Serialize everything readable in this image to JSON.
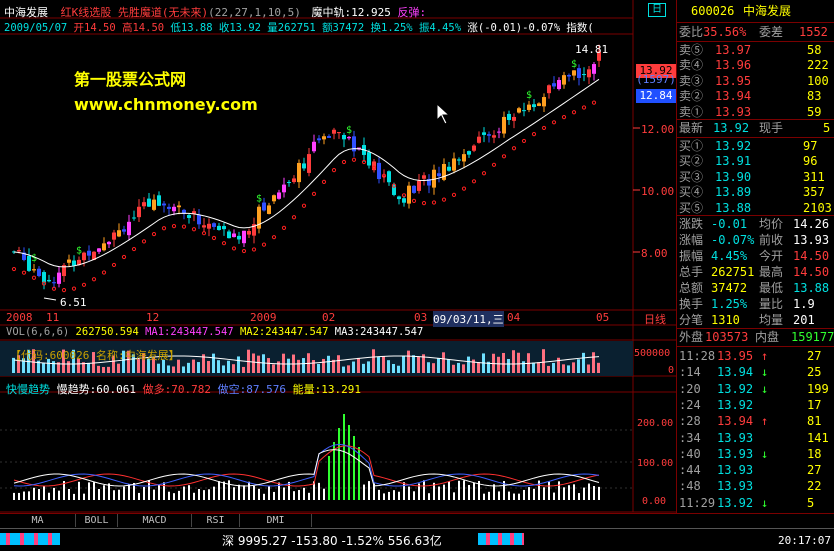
{
  "header": {
    "stock_name": "中海发展",
    "indicator_name": "红K线选股 先胜魔道(无未来)",
    "indicator_params": "(22,27,1,10,5)",
    "demon_line": "魔中轨:12.925",
    "rebound": "反弹:",
    "date": "2009/05/07",
    "open": "开14.50",
    "high": "高14.50",
    "low": "低13.88",
    "close": "收13.92",
    "volume": "量262751",
    "amount": "额37472",
    "turnover": "换1.25%",
    "amplitude": "振4.45%",
    "change": "涨(-0.01)-0.07%",
    "index_label": "指数(",
    "window_btn": "日"
  },
  "watermark": {
    "line1": "第一股票公式网",
    "line2": "www.chnmoney.com"
  },
  "price_axis": {
    "ticks": [
      "13.92",
      "(1597)",
      "12.84",
      "12.00",
      "10.00",
      "8.00"
    ],
    "max_label": "14.81",
    "min_label": "6.51"
  },
  "time_axis": {
    "labels": [
      "2008",
      "11",
      "12",
      "2009",
      "02",
      "03",
      "09/03/11,三",
      "04",
      "05"
    ],
    "period": "日线"
  },
  "volume_panel": {
    "title": "VOL(6,6,6)",
    "vol": "262750.594",
    "ma1": "MA1:243447.547",
    "ma2": "MA2:243447.547",
    "ma3": "MA3:243447.547",
    "banner": "【代码:600026  名称:中海发展】",
    "axis": [
      "500000",
      "0"
    ]
  },
  "indicator_panel": {
    "fast": "快慢趋势",
    "slow": "慢趋势:60.061",
    "short": "做多:70.782",
    "empty": "做空:87.576",
    "energy": "能量:13.291",
    "axis": [
      "200.00",
      "100.00",
      "0.00"
    ]
  },
  "quote_panel": {
    "code": "600026",
    "name": "中海发展",
    "weibi_label": "委比",
    "weibi": "35.56%",
    "weicha_label": "委差",
    "weicha": "1552",
    "sells": [
      {
        "label": "卖⑤",
        "price": "13.97",
        "vol": "58"
      },
      {
        "label": "卖④",
        "price": "13.96",
        "vol": "222"
      },
      {
        "label": "卖③",
        "price": "13.95",
        "vol": "100"
      },
      {
        "label": "卖②",
        "price": "13.94",
        "vol": "83"
      },
      {
        "label": "卖①",
        "price": "13.93",
        "vol": "59"
      }
    ],
    "latest_label": "最新",
    "latest": "13.92",
    "cur_label": "现手",
    "cur": "5",
    "buys": [
      {
        "label": "买①",
        "price": "13.92",
        "vol": "97"
      },
      {
        "label": "买②",
        "price": "13.91",
        "vol": "96"
      },
      {
        "label": "买③",
        "price": "13.90",
        "vol": "311"
      },
      {
        "label": "买④",
        "price": "13.89",
        "vol": "357"
      },
      {
        "label": "买⑤",
        "price": "13.88",
        "vol": "2103"
      }
    ],
    "stats": [
      {
        "l1": "涨跌",
        "v1": "-0.01",
        "l2": "均价",
        "v2": "14.26"
      },
      {
        "l1": "涨幅",
        "v1": "-0.07%",
        "l2": "前收",
        "v2": "13.93"
      },
      {
        "l1": "振幅",
        "v1": "4.45%",
        "l2": "今开",
        "v2": "14.50"
      },
      {
        "l1": "总手",
        "v1": "262751",
        "l2": "最高",
        "v2": "14.50"
      },
      {
        "l1": "总额",
        "v1": "37472",
        "l2": "最低",
        "v2": "13.88"
      },
      {
        "l1": "换手",
        "v1": "1.25%",
        "l2": "量比",
        "v2": "1.9"
      },
      {
        "l1": "分笔",
        "v1": "1310",
        "l2": "均量",
        "v2": "201"
      }
    ],
    "outer_label": "外盘",
    "outer": "103573",
    "inner_label": "内盘",
    "inner": "159177"
  },
  "ticks": [
    {
      "time": "11:28",
      "price": "13.95",
      "arrow": "↑",
      "vol": "27"
    },
    {
      "time": ":14",
      "price": "13.94",
      "arrow": "↓",
      "vol": "25"
    },
    {
      "time": ":20",
      "price": "13.92",
      "arrow": "↓",
      "vol": "199"
    },
    {
      "time": ":24",
      "price": "13.92",
      "arrow": "",
      "vol": "17"
    },
    {
      "time": ":28",
      "price": "13.94",
      "arrow": "↑",
      "vol": "81"
    },
    {
      "time": ":34",
      "price": "13.93",
      "arrow": "",
      "vol": "141"
    },
    {
      "time": ":40",
      "price": "13.93",
      "arrow": "↓",
      "vol": "18"
    },
    {
      "time": ":44",
      "price": "13.93",
      "arrow": "",
      "vol": "27"
    },
    {
      "time": ":48",
      "price": "13.93",
      "arrow": "",
      "vol": "22"
    },
    {
      "time": "11:29",
      "price": "13.92",
      "arrow": "↓",
      "vol": "5"
    }
  ],
  "tabs": [
    "MA",
    "BOLL",
    "MACD",
    "RSI",
    "DMI"
  ],
  "status": {
    "index_name": "深",
    "index_value": "9995.27",
    "index_change": "-153.80",
    "index_pct": "-1.52%",
    "index_amount": "556.63亿",
    "clock": "20:17:07"
  },
  "colors": {
    "up": "#ff3c3c",
    "down": "#00e0e0",
    "grid": "#7a0000",
    "ma_line": "#ffffff",
    "sar": "#ff2020"
  }
}
